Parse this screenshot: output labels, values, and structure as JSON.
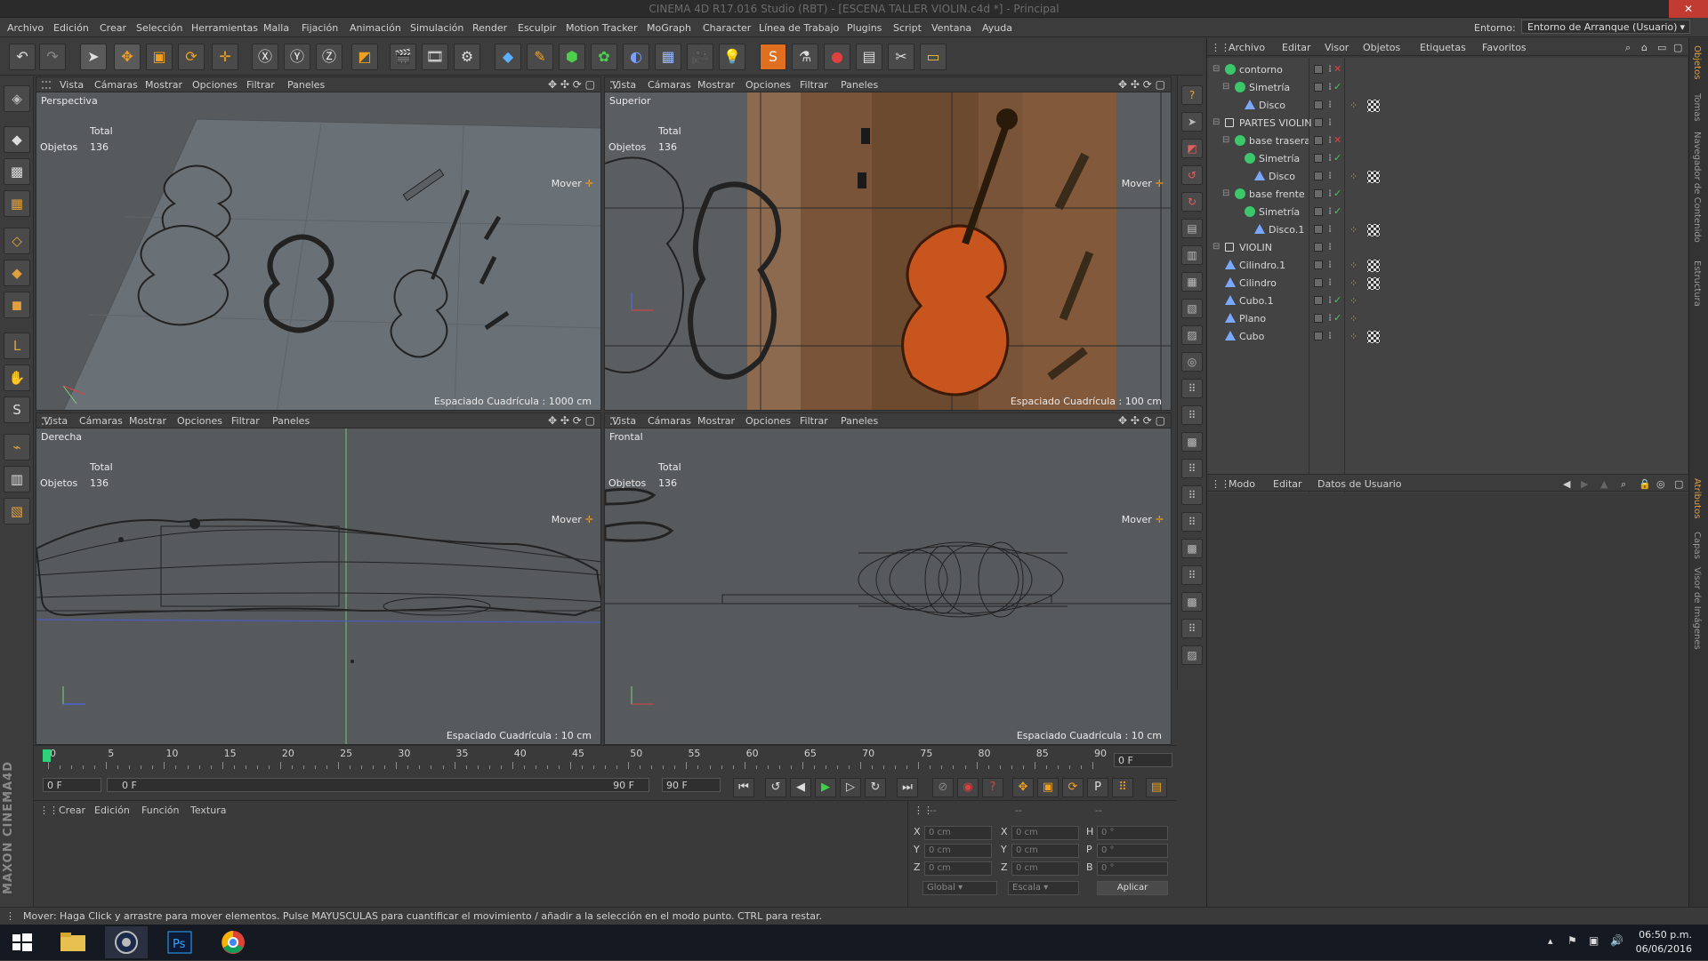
{
  "window": {
    "title": "CINEMA 4D R17.016 Studio (RBT) - [ESCENA TALLER VIOLIN.c4d *] - Principal",
    "close_glyph": "✕"
  },
  "menubar": {
    "items": [
      "Archivo",
      "Edición",
      "Crear",
      "Selección",
      "Herramientas",
      "Malla",
      "Fijación",
      "Animación",
      "Simulación",
      "Render",
      "Esculpir",
      "Motion Tracker",
      "MoGraph",
      "Character",
      "Línea de Trabajo",
      "Plugins",
      "Script",
      "Ventana",
      "Ayuda"
    ],
    "entorno_label": "Entorno:",
    "entorno_value": "Entorno de Arranque (Usuario)"
  },
  "viewport_menu": [
    "Vista",
    "Cámaras",
    "Mostrar",
    "Opciones",
    "Filtrar",
    "Paneles"
  ],
  "viewports": [
    {
      "name": "Perspectiva",
      "total_label": "Total",
      "objects_label": "Objetos",
      "objects_count": "136",
      "mover": "Mover",
      "grid": "Espaciado Cuadrícula : 1000 cm"
    },
    {
      "name": "Superior",
      "total_label": "Total",
      "objects_label": "Objetos",
      "objects_count": "136",
      "mover": "Mover",
      "grid": "Espaciado Cuadrícula : 100 cm"
    },
    {
      "name": "Derecha",
      "total_label": "Total",
      "objects_label": "Objetos",
      "objects_count": "136",
      "mover": "Mover",
      "grid": "Espaciado Cuadrícula : 10 cm"
    },
    {
      "name": "Frontal",
      "total_label": "Total",
      "objects_label": "Objetos",
      "objects_count": "136",
      "mover": "Mover",
      "grid": "Espaciado Cuadrícula : 10 cm"
    }
  ],
  "object_manager": {
    "menu": [
      "Archivo",
      "Editar",
      "Visor",
      "Objetos",
      "Etiquetas",
      "Favoritos"
    ],
    "objects": [
      {
        "name": "contorno",
        "depth": 0,
        "icon": "green",
        "mark": "x"
      },
      {
        "name": "Simetría",
        "depth": 1,
        "icon": "green",
        "mark": "check"
      },
      {
        "name": "Disco",
        "depth": 2,
        "icon": "blue",
        "mark": "",
        "tags": 2
      },
      {
        "name": "PARTES VIOLIN",
        "depth": 0,
        "icon": "null",
        "mark": ""
      },
      {
        "name": "base trasera",
        "depth": 1,
        "icon": "green",
        "mark": "x"
      },
      {
        "name": "Simetría",
        "depth": 2,
        "icon": "green",
        "mark": "check"
      },
      {
        "name": "Disco",
        "depth": 3,
        "icon": "blue",
        "mark": "",
        "tags": 2
      },
      {
        "name": "base frente",
        "depth": 1,
        "icon": "green",
        "mark": "check"
      },
      {
        "name": "Simetría",
        "depth": 2,
        "icon": "green",
        "mark": "check"
      },
      {
        "name": "Disco.1",
        "depth": 3,
        "icon": "blue",
        "mark": "",
        "tags": 2
      },
      {
        "name": "VIOLIN",
        "depth": 0,
        "icon": "null",
        "mark": ""
      },
      {
        "name": "Cilindro.1",
        "depth": 0,
        "icon": "blue",
        "mark": "",
        "tags": 2
      },
      {
        "name": "Cilindro",
        "depth": 0,
        "icon": "blue",
        "mark": "",
        "tags": 2
      },
      {
        "name": "Cubo.1",
        "depth": 0,
        "icon": "blue",
        "mark": "check",
        "tags": 1
      },
      {
        "name": "Plano",
        "depth": 0,
        "icon": "blue",
        "mark": "check",
        "tags": 1
      },
      {
        "name": "Cubo",
        "depth": 0,
        "icon": "blue",
        "mark": "",
        "tags": 2
      }
    ]
  },
  "attribute_manager": {
    "menu": [
      "Modo",
      "Editar",
      "Datos de Usuario"
    ]
  },
  "side_tabs": [
    "Objetos",
    "Tomas",
    "Navegador de Contenido",
    "Estructura",
    "Atributos",
    "Capas",
    "Visor de Imágenes"
  ],
  "timeline": {
    "ticks": [
      "0",
      "5",
      "10",
      "15",
      "20",
      "25",
      "30",
      "35",
      "40",
      "45",
      "50",
      "55",
      "60",
      "65",
      "70",
      "75",
      "80",
      "85",
      "90"
    ],
    "current_frame": "0 F",
    "start_frame": "0 F",
    "range_start": "0 F",
    "range_end": "90 F",
    "end_frame": "90 F"
  },
  "material_manager": {
    "menu": [
      "Crear",
      "Edición",
      "Función",
      "Textura"
    ]
  },
  "coordinates": {
    "header": [
      "--",
      "--",
      "--"
    ],
    "rows": [
      {
        "label": "X",
        "pos": "0 cm",
        "size_label": "X",
        "size": "0 cm",
        "rot_label": "H",
        "rot": "0 °"
      },
      {
        "label": "Y",
        "pos": "0 cm",
        "size_label": "Y",
        "size": "0 cm",
        "rot_label": "P",
        "rot": "0 °"
      },
      {
        "label": "Z",
        "pos": "0 cm",
        "size_label": "Z",
        "size": "0 cm",
        "rot_label": "B",
        "rot": "0 °"
      }
    ],
    "mode1": "Global",
    "mode2": "Escala",
    "apply": "Aplicar"
  },
  "status": "Mover: Haga Click y arrastre para mover elementos. Pulse MAYUSCULAS para cuantificar el movimiento / añadir a la selección en el modo punto. CTRL para restar.",
  "brand": "MAXON CINEMA4D",
  "taskbar": {
    "time": "06:50 p.m.",
    "date": "06/06/2016"
  },
  "colors": {
    "accent": "#f0a020",
    "viewport_bg": "#575a5d",
    "panel_bg": "#3a3a3a",
    "close": "#c23b32"
  }
}
